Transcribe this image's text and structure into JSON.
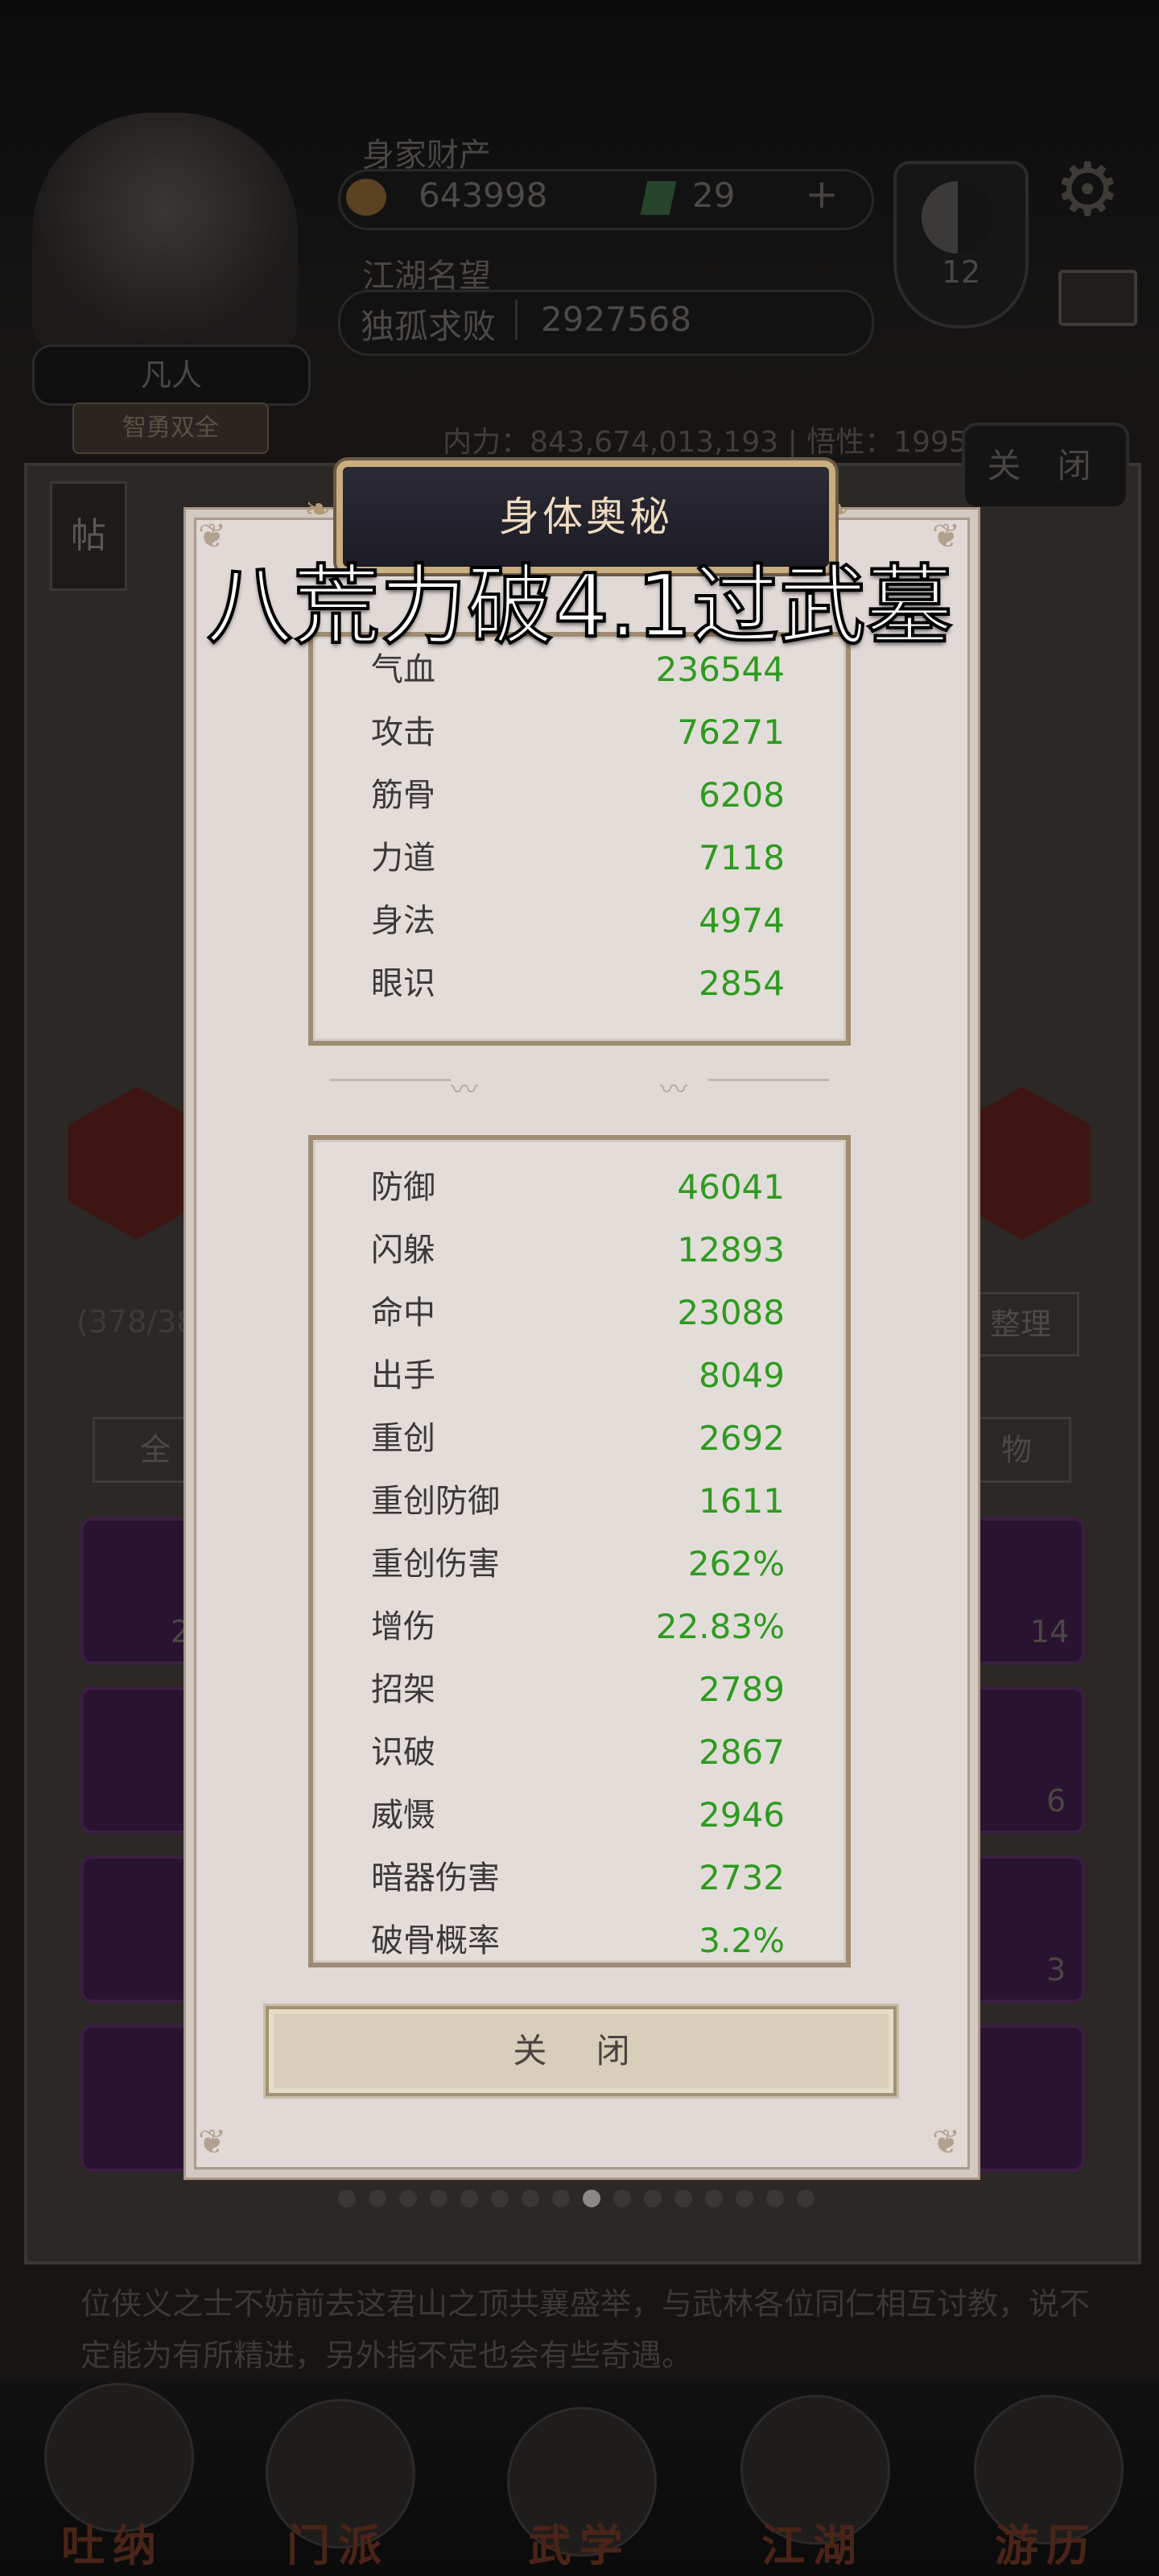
{
  "header": {
    "wealth_label": "身家财产",
    "coins": "643998",
    "gems": "29",
    "plus": "+",
    "fame_label": "江湖名望",
    "fame_title": "独孤求败",
    "fame_value": "2927568",
    "rank": "凡人",
    "rank_sub": "智勇双全",
    "level_badge": "12",
    "stat_strip": "内力：843,674,013,193  | 悟性：1995"
  },
  "background": {
    "close_label": "关 闭",
    "inventory_count": "(378/38",
    "sort_label": "整理",
    "tab_all": "全",
    "tab_item": "物",
    "slot_counts": [
      "2",
      "14",
      "6",
      "3"
    ],
    "description": "位侠义之士不妨前去这君山之顶共襄盛举，与武林各位同仁相互讨教，说不定能为有所精进，另外指不定也会有些奇遇。",
    "nav": [
      "吐纳",
      "门派",
      "武学",
      "江湖",
      "游历"
    ],
    "post_icon_label": "帖"
  },
  "modal": {
    "title": "身体奥秘",
    "overlay_caption": "八荒力破4.1过武墓",
    "close_label": "关 闭",
    "primary_stats": [
      {
        "name": "气血",
        "value": "236544"
      },
      {
        "name": "攻击",
        "value": "76271"
      },
      {
        "name": "筋骨",
        "value": "6208"
      },
      {
        "name": "力道",
        "value": "7118"
      },
      {
        "name": "身法",
        "value": "4974"
      },
      {
        "name": "眼识",
        "value": "2854"
      }
    ],
    "secondary_stats": [
      {
        "name": "防御",
        "value": "46041"
      },
      {
        "name": "闪躲",
        "value": "12893"
      },
      {
        "name": "命中",
        "value": "23088"
      },
      {
        "name": "出手",
        "value": "8049"
      },
      {
        "name": "重创",
        "value": "2692"
      },
      {
        "name": "重创防御",
        "value": "1611"
      },
      {
        "name": "重创伤害",
        "value": "262%"
      },
      {
        "name": "增伤",
        "value": "22.83%"
      },
      {
        "name": "招架",
        "value": "2789"
      },
      {
        "name": "识破",
        "value": "2867"
      },
      {
        "name": "威慑",
        "value": "2946"
      },
      {
        "name": "暗器伤害",
        "value": "2732"
      },
      {
        "name": "破骨概率",
        "value": "3.2%"
      }
    ],
    "page_count": 16,
    "active_page": 8
  },
  "colors": {
    "stat_value": "#2f9a21",
    "modal_bg": "#e0d9d6",
    "title_plate": "#2b2a35",
    "frame": "#9e8c73"
  }
}
